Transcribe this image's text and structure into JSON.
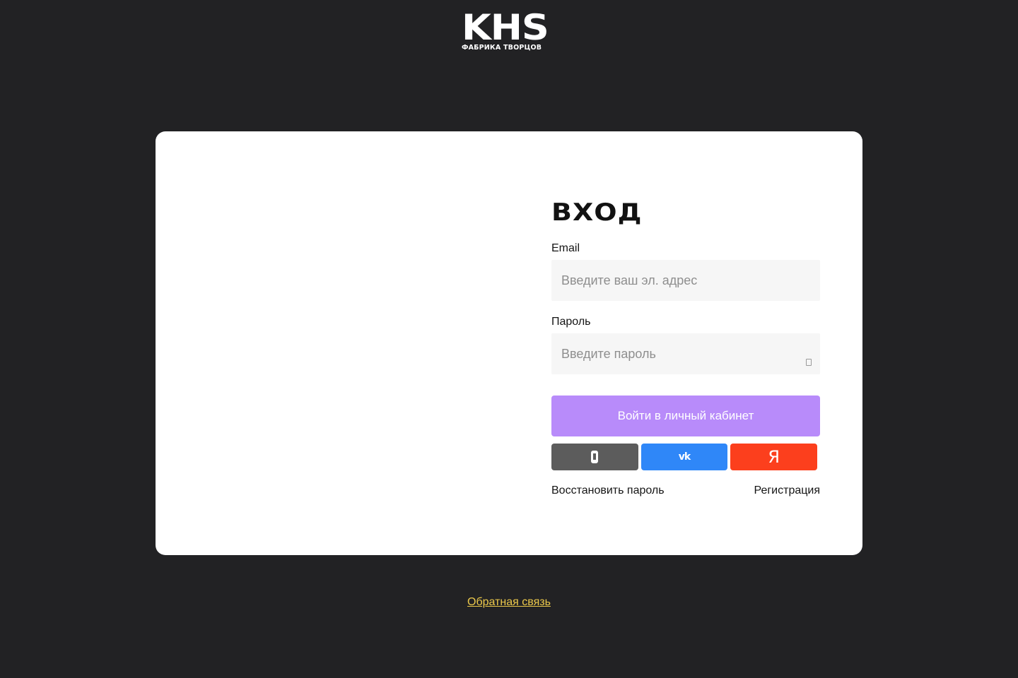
{
  "brand": {
    "logo_main": "KHS",
    "logo_sub": "ФАБРИКА ТВОРЦОВ"
  },
  "login": {
    "title": "ВХОД",
    "email": {
      "label": "Email",
      "placeholder": "Введите ваш эл. адрес",
      "value": ""
    },
    "password": {
      "label": "Пароль",
      "placeholder": "Введите пароль",
      "value": ""
    },
    "submit_label": "Войти в личный кабинет",
    "social": {
      "phone_icon": "phone-icon",
      "vk_label": "vk",
      "yandex_label": "Я"
    },
    "recover_link": "Восстановить пароль",
    "register_link": "Регистрация"
  },
  "footer": {
    "feedback_link": "Обратная связь"
  },
  "colors": {
    "background": "#222224",
    "card": "#ffffff",
    "submit": "#b88bfa",
    "phone_button": "#5c5c5c",
    "vk_button": "#2f87f8",
    "yandex_button": "#fc3f1d",
    "feedback_link": "#ecc94b"
  }
}
